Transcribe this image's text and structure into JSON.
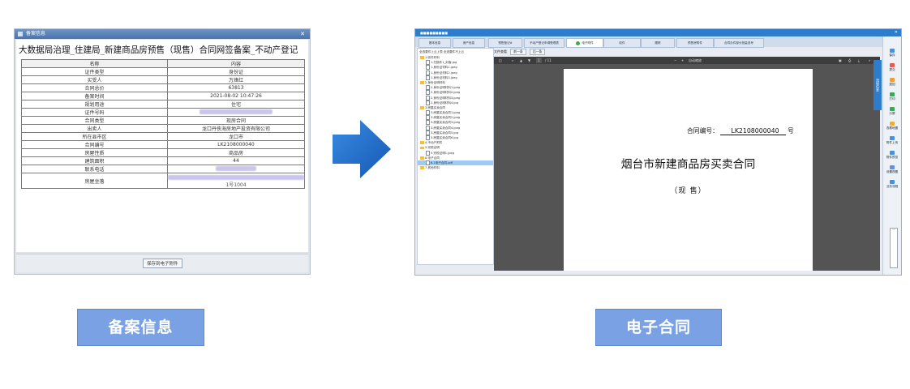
{
  "filing_window": {
    "title": "备案信息",
    "doc_title": "大数据局治理_住建局_新建商品房预售（现售）合同网签备案_不动产登记",
    "header": [
      "名称",
      "内容"
    ],
    "rows": [
      {
        "k": "证件类型",
        "v": "身份证"
      },
      {
        "k": "买受人",
        "v": "万烽红"
      },
      {
        "k": "合同总价",
        "v": "63813"
      },
      {
        "k": "备案时间",
        "v": "2021-08-02 10:47:26"
      },
      {
        "k": "规划用途",
        "v": "住宅"
      },
      {
        "k": "证件号码",
        "v": "",
        "redacted": true
      },
      {
        "k": "合同类型",
        "v": "现房合同"
      },
      {
        "k": "出卖人",
        "v": "龙口丹侠海房地产投资有限公司"
      },
      {
        "k": "所在县市区",
        "v": "龙口市"
      },
      {
        "k": "合同编号",
        "v": "LK2108000040"
      },
      {
        "k": "房屋性质",
        "v": "商品房"
      },
      {
        "k": "建筑面积",
        "v": "44"
      },
      {
        "k": "联系电话",
        "v": "",
        "redacted": true
      },
      {
        "k": "房屋坐落",
        "v": "1号1004",
        "redacted": true
      }
    ],
    "save_button": "保存到电子附件"
  },
  "contract_window": {
    "tabs": [
      "基本信息",
      "房产信息",
      "预售登记#",
      "不动产登记申请受理表",
      "电子附件",
      "收件",
      "跟踪",
      "预售房附件",
      "合同办件部分批量选号"
    ],
    "active_tab": "电子附件",
    "tree_toolbar": "全选要件上云上表  全选要件不上云",
    "tree": [
      {
        "type": "folder",
        "label": "1.收件材料"
      },
      {
        "type": "file",
        "label": "1.扫描件1_封面.jpg"
      },
      {
        "type": "file",
        "label": "1.身份证材料1.jpeg"
      },
      {
        "type": "file",
        "label": "1.身份证材料2.jpeg"
      },
      {
        "type": "file",
        "label": "1.身份证材料3.jpeg"
      },
      {
        "type": "folder",
        "label": "2.身份证明材料"
      },
      {
        "type": "file",
        "label": "2.身份证明材料1.jpeg"
      },
      {
        "type": "file",
        "label": "2.身份证明材料2.jpeg"
      },
      {
        "type": "file",
        "label": "2.身份证明材料3.jpeg"
      },
      {
        "type": "file",
        "label": "2.身份证明材料4.jpg"
      },
      {
        "type": "folder",
        "label": "3.房屋买卖合同"
      },
      {
        "type": "file",
        "label": "3.房屋买卖合同1.jpeg"
      },
      {
        "type": "file",
        "label": "3.房屋买卖合同2.jpeg"
      },
      {
        "type": "file",
        "label": "3.房屋买卖合同3.jpeg"
      },
      {
        "type": "file",
        "label": "3.房屋买卖合同4.jpeg"
      },
      {
        "type": "file",
        "label": "3.房屋买卖合同5.jpg"
      },
      {
        "type": "file",
        "label": "3.房屋买卖合同6.jpg"
      },
      {
        "type": "folder",
        "label": "4.不动产附件"
      },
      {
        "type": "folder",
        "label": "5.完税证明"
      },
      {
        "type": "file",
        "label": "5.完税证明1.jpeg"
      },
      {
        "type": "folder",
        "label": "6.电子合同"
      },
      {
        "type": "file",
        "label": "6.1电子合同.pdf",
        "selected": true
      },
      {
        "type": "folder",
        "label": "7.其他材料"
      }
    ],
    "viewer_toolbar": {
      "label": "文件查看",
      "prev": "前一条",
      "next": "后一条"
    },
    "pdf": {
      "page": "1",
      "page_total": "/ 11",
      "zoom": "自动缩放"
    },
    "contract_no_label": "合同编号：",
    "contract_no": "LK2108000040",
    "contract_no_suffix": "号",
    "doc_title": "烟台市新建商品房买卖合同",
    "doc_subtitle": "（现  售）",
    "side_tab": "流程信息",
    "side_buttons": [
      "保存",
      "提交",
      "退回",
      "打印",
      "分屏",
      "查看地图",
      "附件上传",
      "附件预览",
      "设置视图",
      "业务流程"
    ]
  },
  "captions": {
    "left": "备案信息",
    "right": "电子合同"
  },
  "colors": {
    "caption_bg": "#7aa1e3",
    "arrow": "#1e6fd0",
    "titlebar": "#2e7dcc"
  }
}
